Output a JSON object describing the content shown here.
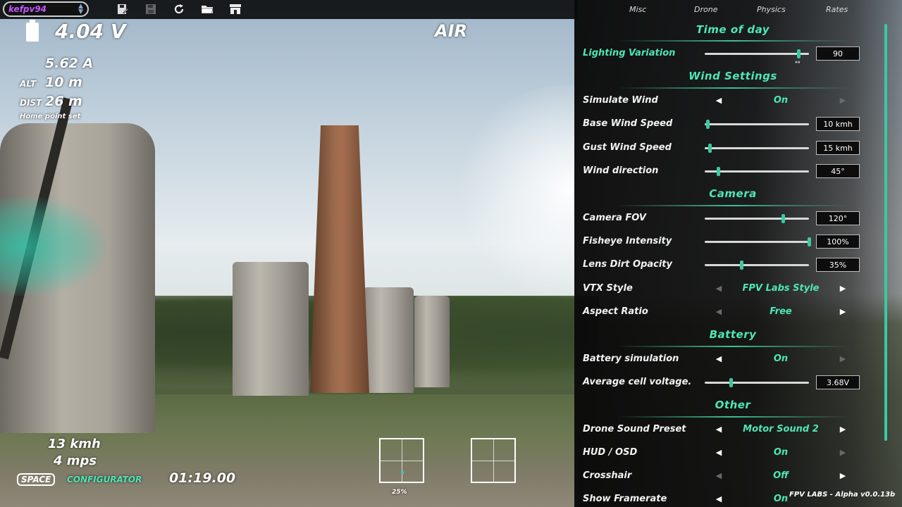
{
  "profile": {
    "name": "kefpv94"
  },
  "toolbar": {
    "icons": [
      "save-as-icon",
      "save-icon",
      "reset-icon",
      "folder-icon",
      "shop-icon"
    ]
  },
  "hud": {
    "voltage": "4.04 V",
    "current": "5.62 A",
    "alt_label": "ALT",
    "alt_value": "10 m",
    "dist_label": "DIST",
    "dist_value": "26 m",
    "home_point": "Home point set",
    "mode": "AIR",
    "speed_kmh": "13 kmh",
    "speed_mps": "4 mps",
    "space_key": "SPACE",
    "configurator": "CONFIGURATOR",
    "timer": "01:19.00",
    "throttle_percent": "25%"
  },
  "tabs": [
    "Misc",
    "Drone",
    "Physics",
    "Rates"
  ],
  "sections": {
    "time_of_day": "Time of day",
    "wind": "Wind Settings",
    "camera": "Camera",
    "battery": "Battery",
    "other": "Other"
  },
  "settings": {
    "lighting": {
      "label": "Lighting Variation",
      "value": "90",
      "level": 0.9
    },
    "simulate_wind": {
      "label": "Simulate Wind",
      "value": "On"
    },
    "base_wind": {
      "label": "Base Wind Speed",
      "value": "10 kmh",
      "level": 0.03
    },
    "gust_wind": {
      "label": "Gust Wind Speed",
      "value": "15 kmh",
      "level": 0.05
    },
    "wind_dir": {
      "label": "Wind direction",
      "value": "45°",
      "level": 0.125
    },
    "fov": {
      "label": "Camera FOV",
      "value": "120°",
      "level": 0.75
    },
    "fisheye": {
      "label": "Fisheye  Intensity",
      "value": "100%",
      "level": 1.0
    },
    "lens_dirt": {
      "label": "Lens Dirt Opacity",
      "value": "35%",
      "level": 0.35
    },
    "vtx_style": {
      "label": "VTX Style",
      "value": "FPV Labs Style"
    },
    "aspect": {
      "label": "Aspect Ratio",
      "value": "Free"
    },
    "battery_sim": {
      "label": "Battery simulation",
      "value": "On"
    },
    "cell_voltage": {
      "label": "Average cell voltage.",
      "value": "3.68V",
      "level": 0.25
    },
    "sound_preset": {
      "label": "Drone Sound Preset",
      "value": "Motor Sound 2"
    },
    "hud_osd": {
      "label": "HUD / OSD",
      "value": "On"
    },
    "crosshair": {
      "label": "Crosshair",
      "value": "Off"
    },
    "framerate": {
      "label": "Show Framerate",
      "value": "On"
    }
  },
  "version": "FPV LABS - Alpha v0.0.13b",
  "colors": {
    "accent": "#4ee6b6",
    "profile": "#c256ff"
  }
}
